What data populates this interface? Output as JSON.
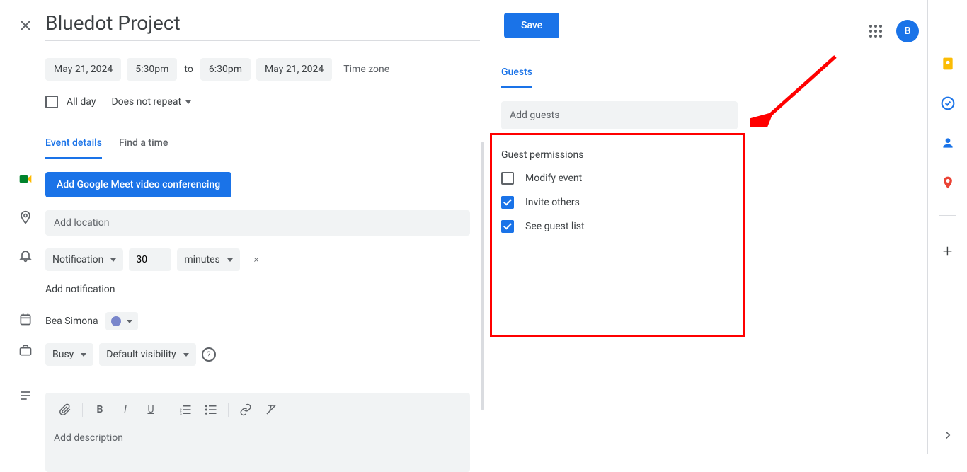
{
  "header": {
    "title": "Bluedot Project",
    "save": "Save",
    "avatar_initial": "B"
  },
  "datetime": {
    "start_date": "May 21, 2024",
    "start_time": "5:30pm",
    "to": "to",
    "end_time": "6:30pm",
    "end_date": "May 21, 2024",
    "timezone": "Time zone",
    "all_day": "All day",
    "repeat": "Does not repeat"
  },
  "tabs": {
    "details": "Event details",
    "find_time": "Find a time"
  },
  "details": {
    "meet_btn": "Add Google Meet video conferencing",
    "location_placeholder": "Add location",
    "notification": {
      "type": "Notification",
      "value": "30",
      "unit": "minutes"
    },
    "add_notification": "Add notification",
    "calendar_owner": "Bea Simona",
    "busy": "Busy",
    "visibility": "Default visibility",
    "description_placeholder": "Add description"
  },
  "guests": {
    "tab": "Guests",
    "input_placeholder": "Add guests",
    "permissions_title": "Guest permissions",
    "modify": "Modify event",
    "invite": "Invite others",
    "see_list": "See guest list"
  }
}
